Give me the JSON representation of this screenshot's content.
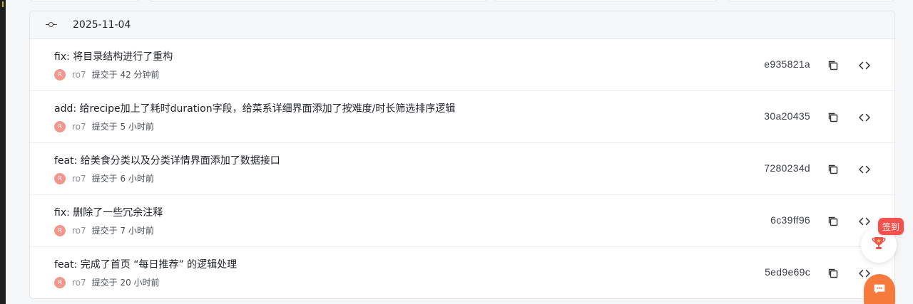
{
  "group": {
    "date": "2025-11-04"
  },
  "commits": [
    {
      "message": "fix: 将目录结构进行了重构",
      "avatar": "R",
      "author": "ro7",
      "time": "提交于 42 分钟前",
      "sha": "e935821a"
    },
    {
      "message": "add: 给recipe加上了耗时duration字段，给菜系详细界面添加了按难度/时长筛选排序逻辑",
      "avatar": "R",
      "author": "ro7",
      "time": "提交于 5 小时前",
      "sha": "30a20435"
    },
    {
      "message": "feat: 给美食分类以及分类详情界面添加了数据接口",
      "avatar": "R",
      "author": "ro7",
      "time": "提交于 6 小时前",
      "sha": "7280234d"
    },
    {
      "message": "fix: 删除了一些冗余注释",
      "avatar": "R",
      "author": "ro7",
      "time": "提交于 7 小时前",
      "sha": "6c39ff96"
    },
    {
      "message": "feat: 完成了首页 “每日推荐” 的逻辑处理",
      "avatar": "R",
      "author": "ro7",
      "time": "提交于 20 小时前",
      "sha": "5ed9e69c"
    }
  ],
  "floating": {
    "sign_label": "签到",
    "trophy_icon": "trophy-icon",
    "chat_icon": "chat-icon",
    "accent": "#f4524d"
  }
}
